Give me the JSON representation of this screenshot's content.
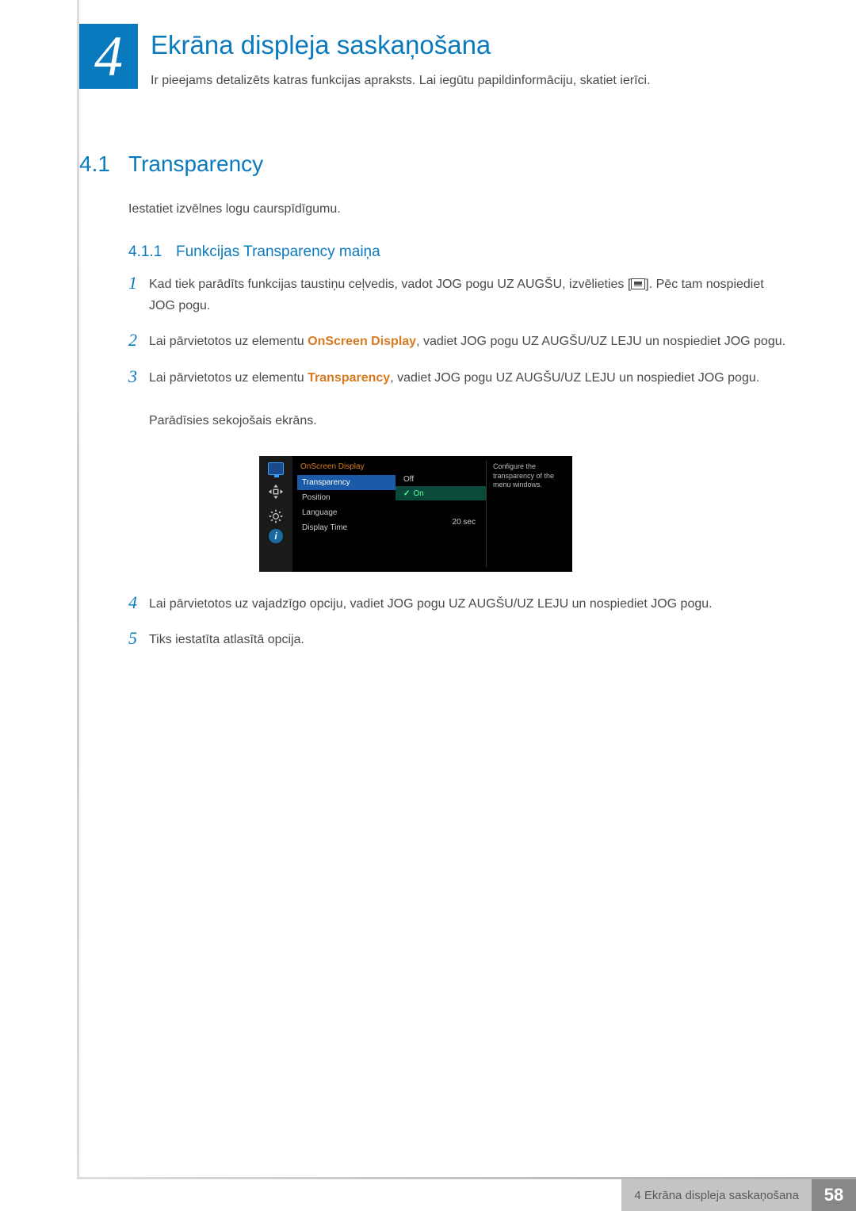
{
  "chapter": {
    "number": "4",
    "title": "Ekrāna displeja saskaņošana",
    "subtitle": "Ir pieejams detalizēts katras funkcijas apraksts. Lai iegūtu papildinformāciju, skatiet ierīci."
  },
  "section": {
    "number": "4.1",
    "title": "Transparency",
    "intro": "Iestatiet izvēlnes logu caurspīdīgumu."
  },
  "subsection": {
    "number": "4.1.1",
    "title": "Funkcijas Transparency maiņa"
  },
  "steps": {
    "s1_a": "Kad tiek parādīts funkcijas taustiņu ceļvedis, vadot JOG pogu UZ AUGŠU, izvēlieties [",
    "s1_b": "]. Pēc tam nospiediet JOG pogu.",
    "s2_a": "Lai pārvietotos uz elementu ",
    "s2_bold": "OnScreen Display",
    "s2_b": ", vadiet JOG pogu UZ AUGŠU/UZ LEJU un nospiediet JOG pogu.",
    "s3_a": "Lai pārvietotos uz elementu ",
    "s3_bold": "Transparency",
    "s3_b": ", vadiet JOG pogu UZ AUGŠU/UZ LEJU un nospiediet JOG pogu.",
    "s3_c": "Parādīsies sekojošais ekrāns.",
    "s4": "Lai pārvietotos uz vajadzīgo opciju, vadiet JOG pogu UZ AUGŠU/UZ LEJU un nospiediet JOG pogu.",
    "s5": "Tiks iestatīta atlasītā opcija."
  },
  "step_numbers": {
    "n1": "1",
    "n2": "2",
    "n3": "3",
    "n4": "4",
    "n5": "5"
  },
  "osd": {
    "menu_title": "OnScreen Display",
    "items": {
      "transparency": "Transparency",
      "position": "Position",
      "language": "Language",
      "display_time": "Display Time"
    },
    "values": {
      "off": "Off",
      "on": "On",
      "time": "20 sec"
    },
    "help": "Configure the transparency of the menu windows.",
    "info_glyph": "i"
  },
  "footer": {
    "title": "4 Ekrāna displeja saskaņošana",
    "page": "58"
  }
}
